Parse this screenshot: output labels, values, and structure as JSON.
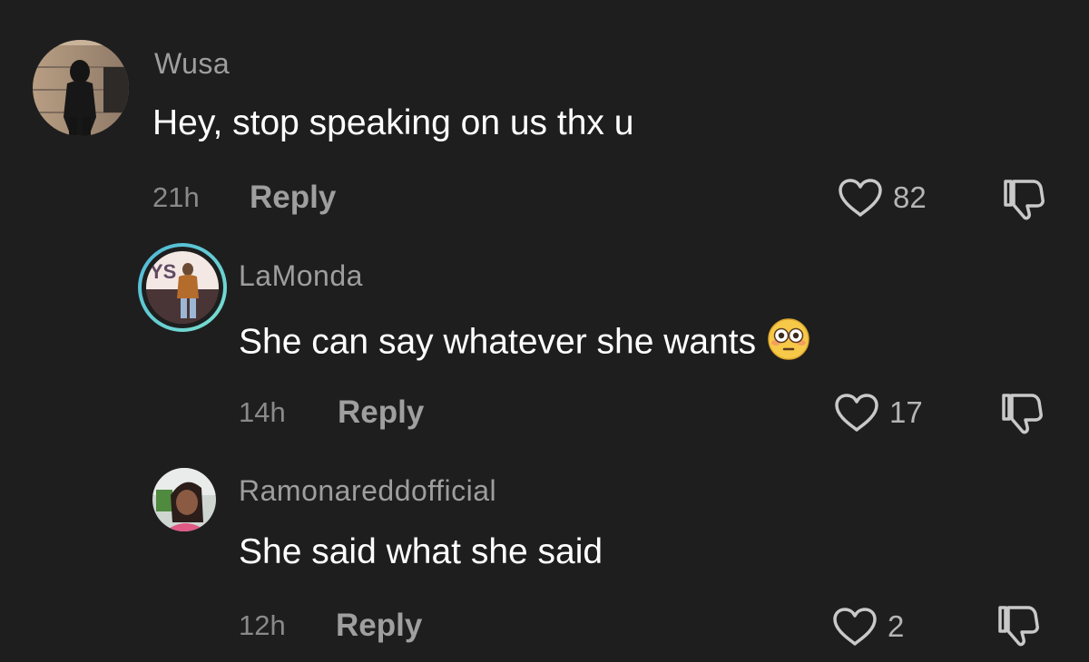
{
  "comments": [
    {
      "username": "Wusa",
      "text": "Hey, stop speaking on us thx u",
      "time": "21h",
      "reply_label": "Reply",
      "likes": "82"
    },
    {
      "username": "LaMonda",
      "text": "She can say whatever she wants",
      "emoji": "flushed-face-icon",
      "time": "14h",
      "reply_label": "Reply",
      "likes": "17"
    },
    {
      "username": "Ramonareddofficial",
      "text": "She said what she said",
      "time": "12h",
      "reply_label": "Reply",
      "likes": "2"
    }
  ],
  "colors": {
    "background": "#1e1e1e",
    "username": "#9e9e9e",
    "muted": "#8a8a8a",
    "story_ring": "#5fd3e6"
  }
}
